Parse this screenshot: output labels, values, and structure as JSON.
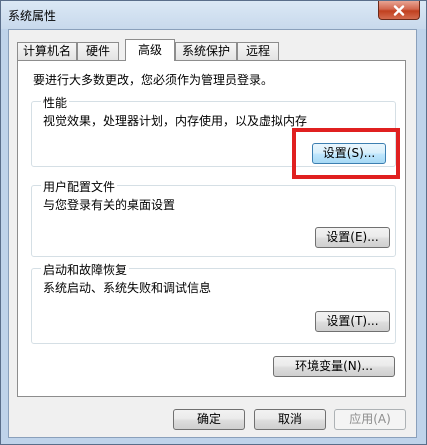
{
  "window": {
    "title": "系统属性",
    "close_icon": "close-icon"
  },
  "tabs": [
    {
      "label": "计算机名",
      "active": false
    },
    {
      "label": "硬件",
      "active": false
    },
    {
      "label": "高级",
      "active": true
    },
    {
      "label": "系统保护",
      "active": false
    },
    {
      "label": "远程",
      "active": false
    }
  ],
  "advanced": {
    "admin_note": "要进行大多数更改，您必须作为管理员登录。",
    "performance": {
      "title": "性能",
      "description": "视觉效果，处理器计划，内存使用，以及虚拟内存",
      "button_label": "设置(S)..."
    },
    "user_profiles": {
      "title": "用户配置文件",
      "description": "与您登录有关的桌面设置",
      "button_label": "设置(E)..."
    },
    "startup_recovery": {
      "title": "启动和故障恢复",
      "description": "系统启动、系统失败和调试信息",
      "button_label": "设置(T)..."
    },
    "env_button_label": "环境变量(N)..."
  },
  "footer": {
    "ok_label": "确定",
    "cancel_label": "取消",
    "apply_label": "应用(A)"
  },
  "annotation": {
    "highlight_color": "#e02020"
  }
}
